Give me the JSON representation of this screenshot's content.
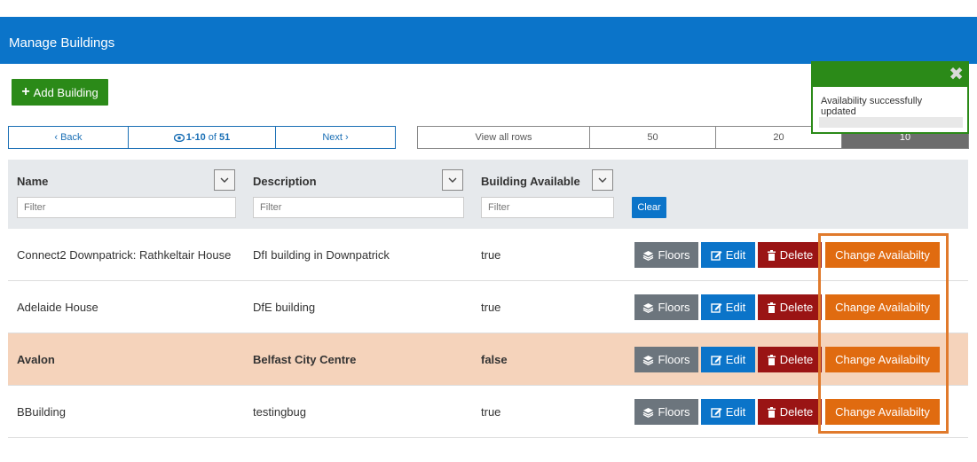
{
  "header": {
    "title": "Manage Buildings"
  },
  "toolbar": {
    "add_label": "Add Building"
  },
  "pager": {
    "back": "Back",
    "range": "1-10",
    "of": "of",
    "total": "51",
    "next": "Next"
  },
  "rows_per_page": {
    "options": [
      "View all rows",
      "50",
      "20",
      "10"
    ],
    "active": "10"
  },
  "columns": [
    {
      "label": "Name",
      "filter_placeholder": "Filter"
    },
    {
      "label": "Description",
      "filter_placeholder": "Filter"
    },
    {
      "label": "Building Available",
      "filter_placeholder": "Filter"
    }
  ],
  "clear_label": "Clear",
  "actions": {
    "floors": "Floors",
    "edit": "Edit",
    "delete": "Delete",
    "change": "Change Availabilty"
  },
  "rows": [
    {
      "name": "Connect2 Downpatrick: Rathkeltair House",
      "description": "DfI building in Downpatrick",
      "available": "true"
    },
    {
      "name": "Adelaide House",
      "description": "DfE building",
      "available": "true"
    },
    {
      "name": "Avalon",
      "description": "Belfast City Centre",
      "available": "false"
    },
    {
      "name": "BBuilding",
      "description": "testingbug",
      "available": "true"
    }
  ],
  "toast": {
    "message": "Availability successfully updated",
    "close_icon": "close-icon"
  },
  "colors": {
    "header": "#0b74c9",
    "success": "#2b8a18",
    "danger": "#9a1414",
    "warning": "#e06b10",
    "highlight_row": "#f5d3bb"
  }
}
